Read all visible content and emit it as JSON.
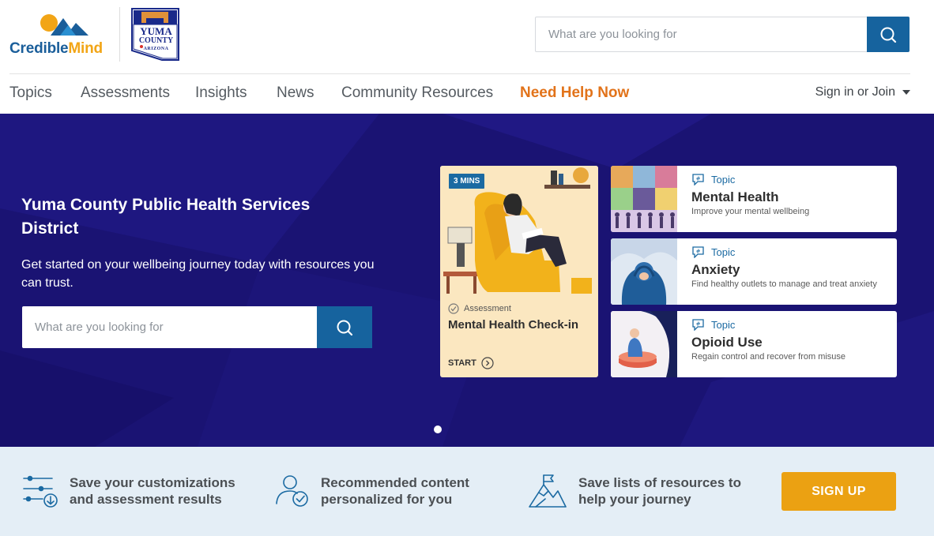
{
  "brand": {
    "name_part1": "Credible",
    "name_part2": "Mind",
    "county_logo_line1": "YUMA",
    "county_logo_line2": "COUNTY",
    "county_logo_line3": "ARIZONA",
    "primary_color": "#1a5e9a",
    "accent_color": "#f2a516"
  },
  "header": {
    "search_placeholder": "What are you looking for",
    "search_icon": "search-icon"
  },
  "nav": {
    "items": [
      "Topics",
      "Assessments",
      "Insights",
      "News",
      "Community Resources"
    ],
    "help_label": "Need Help Now",
    "signin_label": "Sign in or Join",
    "help_color": "#e2731a"
  },
  "hero": {
    "title": "Yuma County Public Health Services District",
    "subtitle": "Get started on your wellbeing journey today with resources you can trust.",
    "search_placeholder": "What are you looking for",
    "background_color": "#1a1373"
  },
  "assessment_card": {
    "badge": "3 MINS",
    "type": "Assessment",
    "title": "Mental Health Check-in",
    "cta": "START"
  },
  "topic_cards": [
    {
      "type": "Topic",
      "title": "Mental Health",
      "description": "Improve your mental wellbeing"
    },
    {
      "type": "Topic",
      "title": "Anxiety",
      "description": "Find healthy outlets to manage and treat anxiety"
    },
    {
      "type": "Topic",
      "title": "Opioid Use",
      "description": "Regain control and recover from misuse"
    }
  ],
  "benefits": [
    {
      "line1": "Save your customizations",
      "line2": "and assessment results",
      "icon": "sliders-icon"
    },
    {
      "line1": "Recommended content",
      "line2": "personalized for you",
      "icon": "user-check-icon"
    },
    {
      "line1": "Save lists of resources to",
      "line2": "help your journey",
      "icon": "mountain-flag-icon"
    }
  ],
  "signup_label": "SIGN UP"
}
